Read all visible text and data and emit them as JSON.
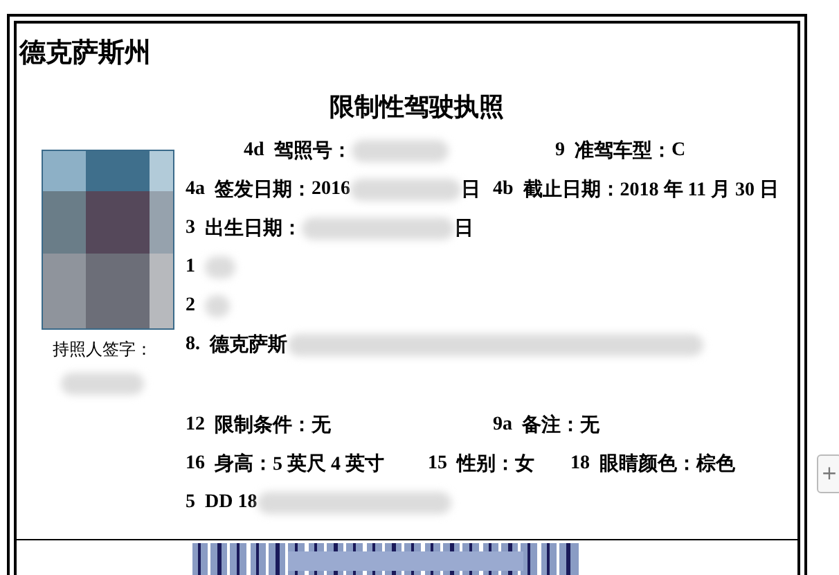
{
  "state_title": "德克萨斯州",
  "license_title": "限制性驾驶执照",
  "signature_label": "持照人签字：",
  "signature_redacted": true,
  "rows": [
    {
      "fields": [
        {
          "code": "4d",
          "label": "驾照号：",
          "redacted": true
        },
        {
          "code": "9",
          "label": "准驾车型：",
          "value": "C",
          "redacted": false
        }
      ]
    },
    {
      "fields": [
        {
          "code": "4a",
          "label": "签发日期：",
          "value": "2016",
          "redacted": true,
          "suffix": "日"
        },
        {
          "code": "4b",
          "label": "截止日期：",
          "value": "2018 年 11 月 30 日",
          "redacted": false
        }
      ]
    },
    {
      "fields": [
        {
          "code": "3",
          "label": "出生日期：",
          "redacted": true,
          "suffix": "日"
        }
      ]
    },
    {
      "fields": [
        {
          "code": "1",
          "redacted": true
        }
      ]
    },
    {
      "fields": [
        {
          "code": "2",
          "redacted": true
        }
      ]
    },
    {
      "fields": [
        {
          "code": "8.",
          "value": "德克萨斯",
          "redacted": true
        }
      ]
    },
    {
      "fields": [
        {
          "code": "12",
          "label": "限制条件：",
          "value": "无",
          "redacted": false
        },
        {
          "code": "9a",
          "label": "备注：",
          "value": "无",
          "redacted": false
        }
      ]
    },
    {
      "fields": [
        {
          "code": "16",
          "label": "身高：",
          "value": "5 英尺 4 英寸",
          "redacted": false
        },
        {
          "code": "15",
          "label": "性别：",
          "value": "女",
          "redacted": false
        },
        {
          "code": "18",
          "label": "眼睛颜色：",
          "value": "棕色",
          "redacted": false
        }
      ]
    },
    {
      "fields": [
        {
          "code": "5",
          "value": "DD 18",
          "redacted": true
        }
      ]
    }
  ],
  "side_button": "+"
}
